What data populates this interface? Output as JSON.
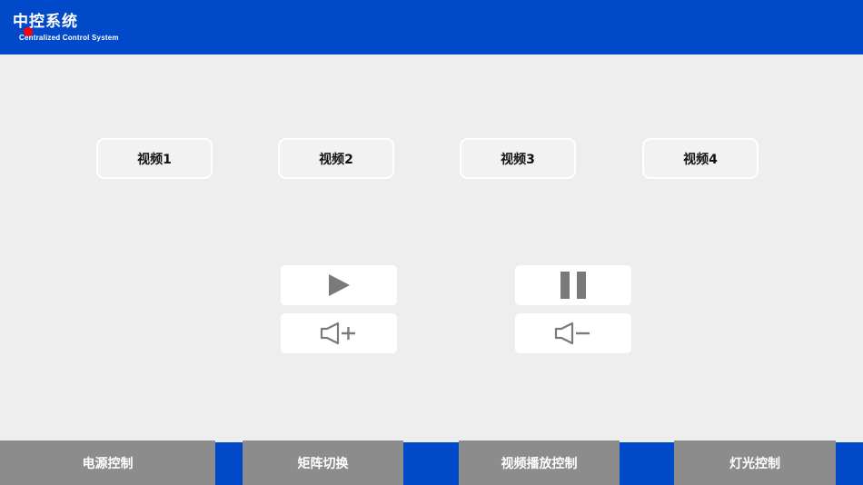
{
  "header": {
    "title": "中控系统",
    "subtitle": "Centralized Control System",
    "status_indicator_color": "#ff0000"
  },
  "video_buttons": [
    {
      "label": "视频1"
    },
    {
      "label": "视频2"
    },
    {
      "label": "视频3"
    },
    {
      "label": "视频4"
    }
  ],
  "playback_controls": {
    "play_icon": "play-icon",
    "pause_icon": "pause-icon",
    "volume_up_icon": "volume-up-icon",
    "volume_down_icon": "volume-down-icon"
  },
  "bottom_nav": [
    {
      "label": "电源控制"
    },
    {
      "label": "矩阵切换"
    },
    {
      "label": "视频播放控制"
    },
    {
      "label": "灯光控制"
    }
  ],
  "colors": {
    "brand_blue": "#0049c8",
    "background": "#eeeeee",
    "nav_button": "#8c8c8c",
    "icon_gray": "#7a7a7a"
  }
}
